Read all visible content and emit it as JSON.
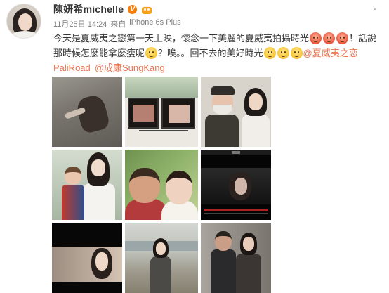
{
  "post": {
    "author": "陳妍希michelle",
    "verified_badge": "V",
    "timestamp": "11月25日 14:24",
    "source_prefix": "来自",
    "source": "iPhone 6s Plus",
    "menu_icon": "chevron-down-icon",
    "content": {
      "line1_text": "今天是夏威夷之戀第一天上映，懷念一下美麗的夏威夷拍攝時光",
      "line1_tail": "！話說",
      "line2_text": "那時候怎麼能拿麼瘦呢",
      "line2_mid": "？唉。。回不去的美好時光",
      "line2_topic": "@夏威夷之恋",
      "line3_topic": "PaliRoad",
      "line3_mention": "@成康SungKang"
    },
    "photos": [
      {
        "id": "photo-1",
        "icon": "photo-icon"
      },
      {
        "id": "photo-2",
        "icon": "photo-icon"
      },
      {
        "id": "photo-3",
        "icon": "photo-icon"
      },
      {
        "id": "photo-4",
        "icon": "photo-icon"
      },
      {
        "id": "photo-5",
        "icon": "photo-icon"
      },
      {
        "id": "photo-6",
        "icon": "photo-icon"
      },
      {
        "id": "photo-7",
        "icon": "photo-icon"
      },
      {
        "id": "photo-8",
        "icon": "photo-icon"
      },
      {
        "id": "photo-9",
        "icon": "photo-icon"
      }
    ]
  },
  "colors": {
    "link": "#eb7350",
    "verified": "#f77c0a",
    "meta_text": "#808080"
  }
}
